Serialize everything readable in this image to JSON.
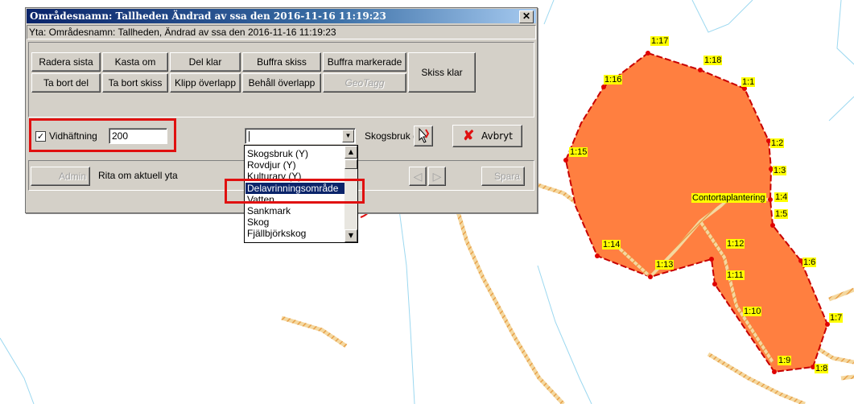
{
  "dialog": {
    "title": "Områdesnamn: Tallheden Ändrad av ssa den 2016-11-16 11:19:23",
    "close_glyph": "✕",
    "subtitle": "Yta: Områdesnamn: Tallheden, Ändrad av ssa den 2016-11-16 11:19:23",
    "toolbar": {
      "radera_sista": "Radera sista",
      "kasta_om": "Kasta om",
      "del_klar": "Del klar",
      "buffra_skiss": "Buffra skiss",
      "buffra_markerade": "Buffra markerade",
      "skiss_klar": "Skiss klar",
      "ta_bort_del": "Ta bort del",
      "ta_bort_skiss": "Ta bort skiss",
      "klipp_overlapp": "Klipp överlapp",
      "behall_overlapp": "Behåll överlapp",
      "geotagg": "GeoTagg"
    },
    "snapping": {
      "label": "Vidhäftning",
      "checked": true,
      "value": "200"
    },
    "type_select": {
      "value": "",
      "options": [
        "Skogsbruk (Y)",
        "Rovdjur (Y)",
        "Kulturarv (Y)",
        "Delavrinningsområde",
        "Vatten",
        "Sankmark",
        "Skog",
        "Fjällbjörkskog"
      ],
      "selected": "Delavrinningsområde"
    },
    "skogsbruk_label": "Skogsbruk (S)",
    "cancel_label": "Avbryt",
    "admin_label": "Admin",
    "status_text": "Rita om aktuell yta",
    "save_label": "Spara"
  },
  "map": {
    "polygon_label": "Contortaplantering",
    "vertex_labels": [
      "1:1",
      "1:2",
      "1:3",
      "1:4",
      "1:5",
      "1:6",
      "1:7",
      "1:8",
      "1:9",
      "1:10",
      "1:11",
      "1:12",
      "1:13",
      "1:14",
      "1:15",
      "1:16",
      "1:17",
      "1:18"
    ],
    "colors": {
      "fill": "#ff7f40",
      "outline": "#c80000",
      "label_bg": "#ffff00",
      "line": "#9cd8f0"
    }
  }
}
